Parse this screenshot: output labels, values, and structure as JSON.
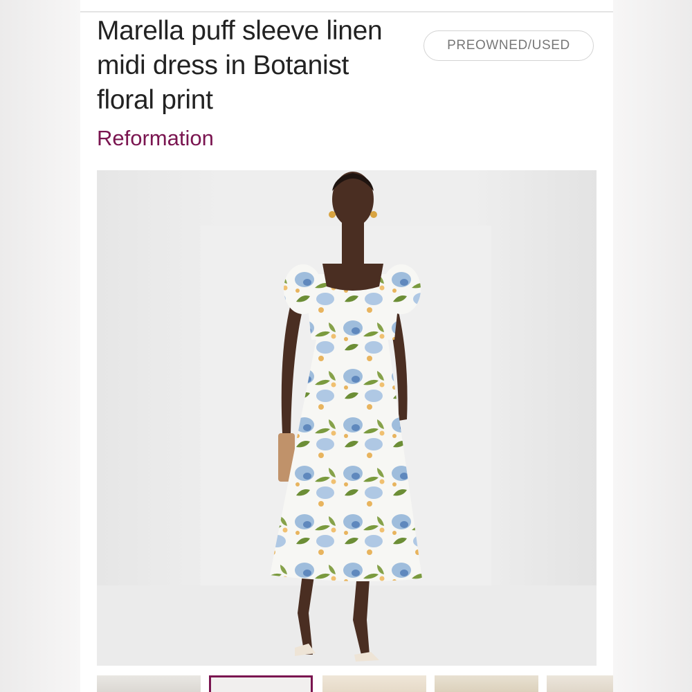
{
  "product": {
    "title": "Marella puff sleeve linen midi dress in Botanist floral print",
    "brand": "Reformation",
    "condition_badge": "PREOWNED/USED",
    "main_image_alt": "Model wearing floral print puff sleeve midi dress"
  },
  "gallery": {
    "thumbnail_count": 5,
    "active_index": 1
  },
  "colors": {
    "brand_accent": "#7a1550",
    "badge_text": "#777777",
    "title_text": "#222222"
  }
}
